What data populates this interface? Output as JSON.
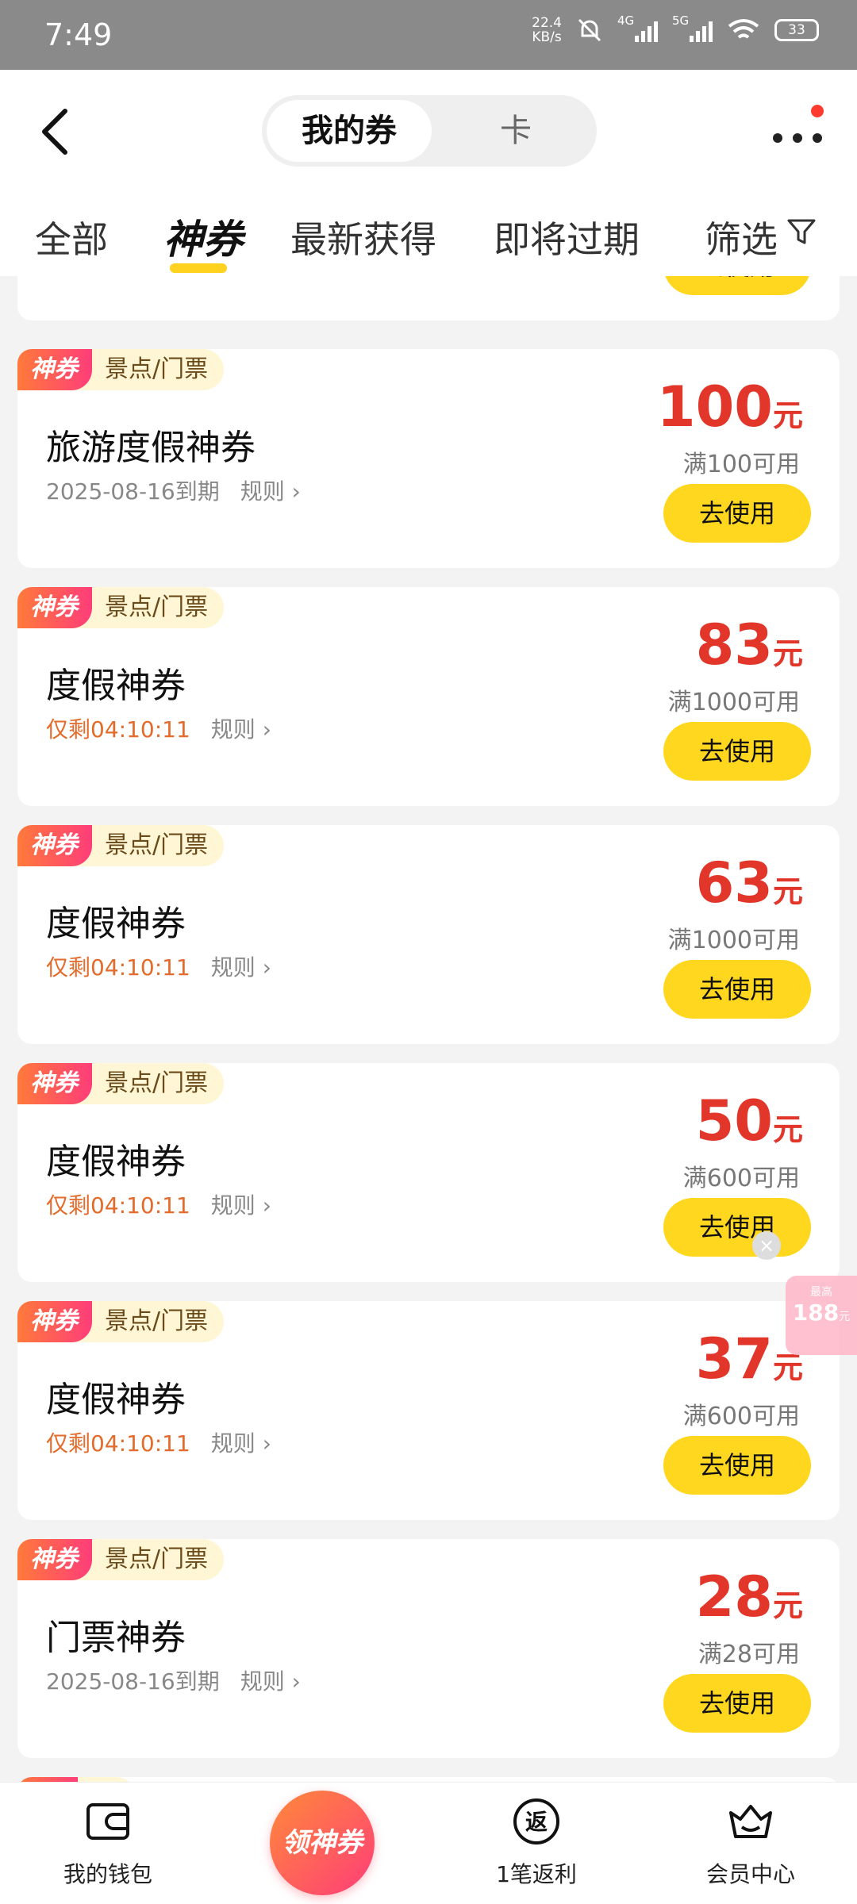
{
  "status_bar": {
    "time": "7:49",
    "speed_value": "22.4",
    "speed_unit": "KB/s",
    "network_1": "4G",
    "network_2": "5G",
    "battery": "33"
  },
  "header": {
    "tabs": [
      "我的券",
      "卡"
    ],
    "active_tab": "我的券"
  },
  "filters": {
    "items": [
      "全部",
      "神券",
      "最新获得",
      "即将过期",
      "筛选"
    ],
    "active": "神券"
  },
  "coupons": [
    {
      "badge": "神券",
      "category": "景点/门票",
      "title": "旅游度假神券",
      "expiry": "2025-08-16到期",
      "rule": "规则",
      "amount": "100",
      "unit": "元",
      "condition": "满100可用",
      "button": "去使用"
    },
    {
      "badge": "神券",
      "category": "景点/门票",
      "title": "度假神券",
      "expiry": "仅剩04:10:11",
      "rule": "规则",
      "amount": "83",
      "unit": "元",
      "condition": "满1000可用",
      "button": "去使用"
    },
    {
      "badge": "神券",
      "category": "景点/门票",
      "title": "度假神券",
      "expiry": "仅剩04:10:11",
      "rule": "规则",
      "amount": "63",
      "unit": "元",
      "condition": "满1000可用",
      "button": "去使用"
    },
    {
      "badge": "神券",
      "category": "景点/门票",
      "title": "度假神券",
      "expiry": "仅剩04:10:11",
      "rule": "规则",
      "amount": "50",
      "unit": "元",
      "condition": "满600可用",
      "button": "去使用"
    },
    {
      "badge": "神券",
      "category": "景点/门票",
      "title": "度假神券",
      "expiry": "仅剩04:10:11",
      "rule": "规则",
      "amount": "37",
      "unit": "元",
      "condition": "满600可用",
      "button": "去使用"
    },
    {
      "badge": "神券",
      "category": "景点/门票",
      "title": "门票神券",
      "expiry": "2025-08-16到期",
      "rule": "规则",
      "amount": "28",
      "unit": "元",
      "condition": "满28可用",
      "button": "去使用"
    }
  ],
  "partial_top_button": "去使用",
  "promo": {
    "small": "最高",
    "big": "188",
    "unit": "元"
  },
  "bottom_nav": {
    "items": [
      "我的钱包",
      "领神券",
      "1笔返利",
      "会员中心"
    ]
  }
}
